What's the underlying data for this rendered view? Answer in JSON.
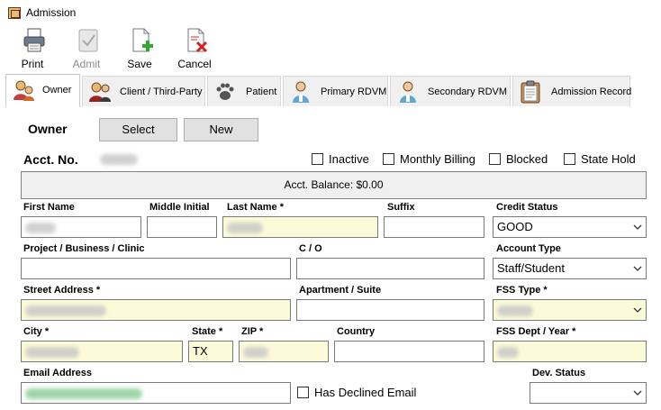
{
  "window": {
    "title": "Admission"
  },
  "toolbar": {
    "print": "Print",
    "admit": "Admit",
    "save": "Save",
    "cancel": "Cancel"
  },
  "tabs": [
    {
      "label": "Owner",
      "icon": "owner-icon"
    },
    {
      "label": "Client / Third-Party",
      "icon": "client-icon"
    },
    {
      "label": "Patient",
      "icon": "paw-icon"
    },
    {
      "label": "Primary RDVM",
      "icon": "doctor-icon"
    },
    {
      "label": "Secondary RDVM",
      "icon": "doctor-icon"
    },
    {
      "label": "Admission Record",
      "icon": "clipboard-icon"
    }
  ],
  "owner": {
    "heading": "Owner",
    "select_btn": "Select",
    "new_btn": "New",
    "acct_label": "Acct. No.",
    "checkboxes": {
      "inactive": "Inactive",
      "monthly": "Monthly Billing",
      "blocked": "Blocked",
      "state_hold": "State Hold"
    },
    "balance": "Acct. Balance: $0.00"
  },
  "form": {
    "first_name_label": "First Name",
    "middle_initial_label": "Middle Initial",
    "last_name_label": "Last Name *",
    "suffix_label": "Suffix",
    "credit_status_label": "Credit Status",
    "credit_status_value": "GOOD",
    "project_label": "Project / Business / Clinic",
    "co_label": "C / O",
    "account_type_label": "Account Type",
    "account_type_value": "Staff/Student",
    "street_label": "Street Address *",
    "apt_label": "Apartment / Suite",
    "fss_type_label": "FSS Type *",
    "city_label": "City *",
    "state_label": "State *",
    "state_value": "TX",
    "zip_label": "ZIP *",
    "country_label": "Country",
    "fss_dept_label": "FSS Dept / Year *",
    "email_label": "Email Address",
    "declined_email_label": "Has Declined Email",
    "dev_status_label": "Dev. Status"
  },
  "colors": {
    "required_field": "#fcfbd8",
    "button_face": "#e1e1e1",
    "balance_bg": "#f0f0f0"
  }
}
